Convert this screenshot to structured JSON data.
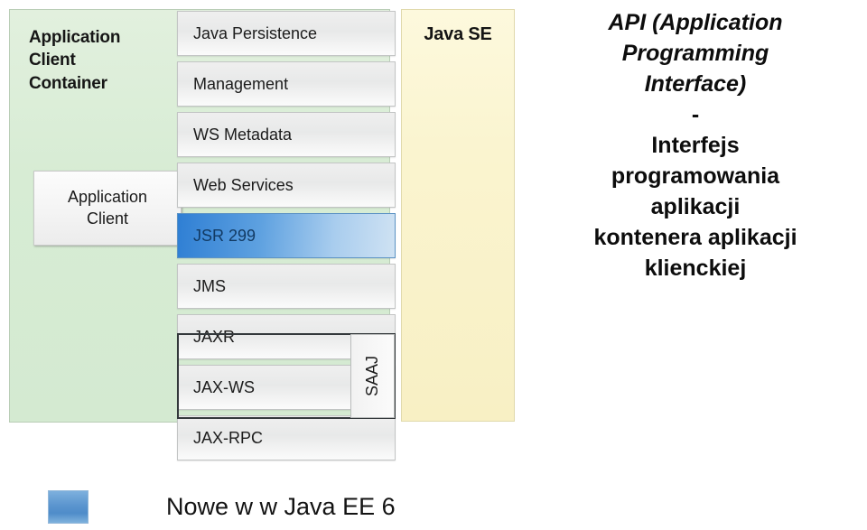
{
  "diagram": {
    "container": {
      "title": "Application\nClient\nContainer",
      "title_lines": [
        "Application",
        "Client",
        "Container"
      ],
      "inner_box_label": "Application\nClient",
      "inner_box_lines": [
        "Application",
        "Client"
      ],
      "fill_color": "#d7ecd4",
      "border_color": "#b9cdb6"
    },
    "api_stack": {
      "rows": [
        {
          "label": "Java Persistence",
          "highlighted": false
        },
        {
          "label": "Management",
          "highlighted": false
        },
        {
          "label": "WS Metadata",
          "highlighted": false
        },
        {
          "label": "Web Services",
          "highlighted": false
        },
        {
          "label": "JSR 299",
          "highlighted": true
        },
        {
          "label": "JMS",
          "highlighted": false
        },
        {
          "label": "JAXR",
          "highlighted": false
        },
        {
          "label": "JAX-WS",
          "highlighted": false
        },
        {
          "label": "JAX-RPC",
          "highlighted": false
        }
      ],
      "highlight_color": "#5ea1e0",
      "row_fill_color": "#ececec"
    },
    "saaj_column": {
      "label": "SAAJ",
      "orientation": "vertical"
    },
    "java_se": {
      "title": "Java SE",
      "fill_color": "#faf4cf",
      "border_color": "#e0d9ac"
    }
  },
  "description": {
    "lines": [
      {
        "text": "API (Application",
        "italic": true
      },
      {
        "text": "Programming",
        "italic": true
      },
      {
        "text": "Interface)",
        "italic": true
      },
      {
        "text": "-",
        "italic": false
      },
      {
        "text": "Interfejs",
        "italic": false
      },
      {
        "text": "programowania",
        "italic": false
      },
      {
        "text": "aplikacji",
        "italic": false
      },
      {
        "text": "kontenera aplikacji",
        "italic": false
      },
      {
        "text": "klienckiej",
        "italic": false
      }
    ]
  },
  "footer": {
    "legend_label": "Nowe w w Java EE 6",
    "legend_swatch_color": "#5b95cf"
  }
}
